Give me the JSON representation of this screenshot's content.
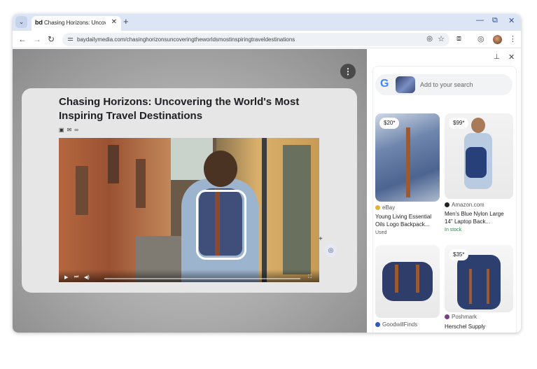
{
  "browser": {
    "tab_title": "Chasing Horizons: Uncover",
    "tab_close": "✕",
    "new_tab": "+",
    "url": "baydailymedia.com/chasinghorizonsuncoveringtheworldsmostinspiringtraveldestinations",
    "controls": {
      "minimize": "—",
      "restore": "⧉",
      "close": "✕"
    }
  },
  "article": {
    "headline": "Chasing Horizons: Uncovering the World's Most Inspiring Travel Destinations",
    "share_icons": [
      "comment-icon",
      "mail-icon",
      "link-icon"
    ]
  },
  "lens_panel": {
    "search_placeholder": "Add to your search",
    "results": [
      {
        "price": "$20*",
        "source": "eBay",
        "title": "Young Living Essential Oils Logo Backpack...",
        "sub": "Used",
        "sub_color": "#555555"
      },
      {
        "price": "$99*",
        "source": "Amazon.com",
        "title": "Men's Blue Nylon Large 14\" Laptop Back...",
        "sub": "In stock",
        "sub_color": "#1e8e3e"
      },
      {
        "price": "",
        "source": "GoodwillFinds",
        "title": "",
        "sub": ""
      },
      {
        "price": "$35*",
        "source": "Poshmark",
        "title": "Herschel Supply",
        "sub": ""
      }
    ]
  },
  "colors": {
    "accent": "#4285f4",
    "tabstrip": "#dbe5f5",
    "stock_green": "#1e8e3e"
  }
}
